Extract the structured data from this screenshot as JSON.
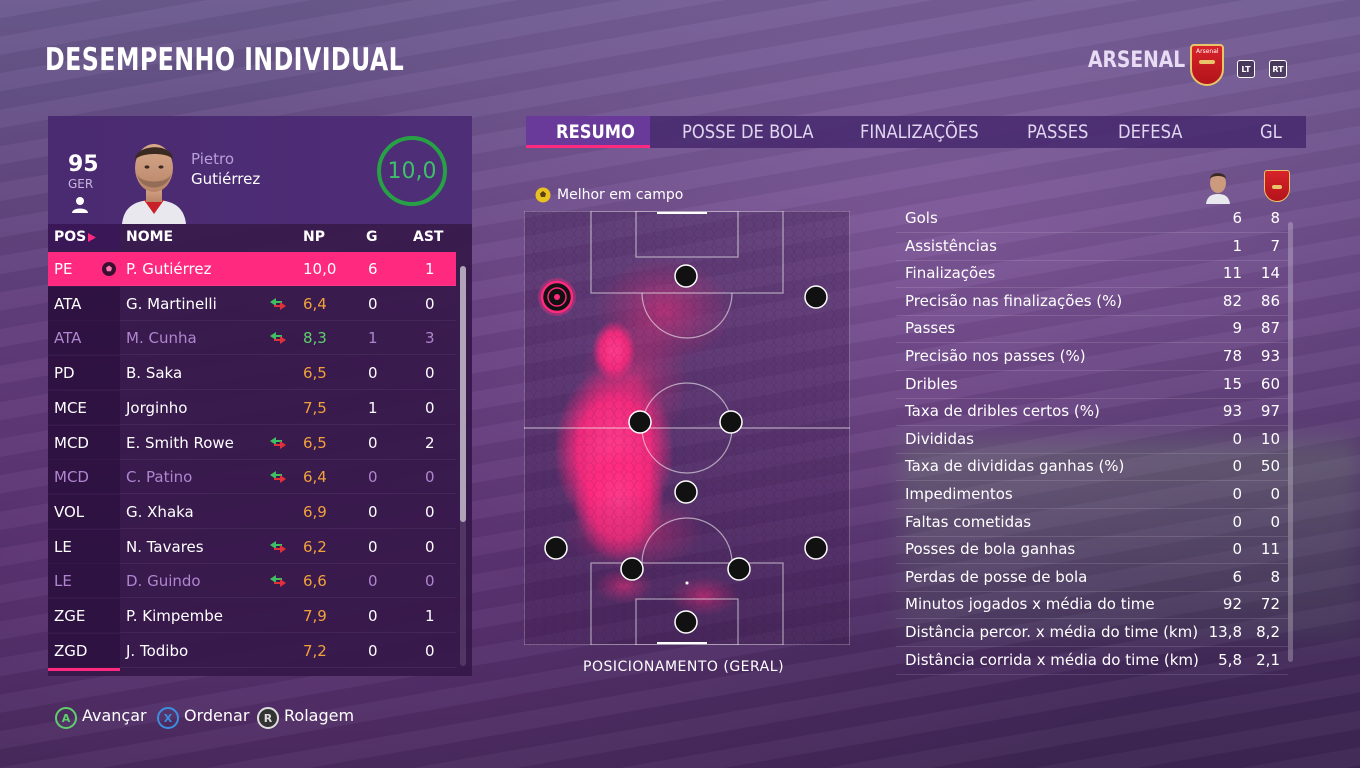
{
  "page_title": "DESEMPENHO INDIVIDUAL",
  "team": {
    "name": "ARSENAL",
    "crest_label": "Arsenal",
    "left_trigger": "LT",
    "right_trigger": "RT"
  },
  "player": {
    "overall": "95",
    "nationality": "GER",
    "first_name": "Pietro",
    "last_name": "Gutiérrez",
    "match_rating": "10,0"
  },
  "table": {
    "headers": {
      "pos": "POS",
      "name": "NOME",
      "np": "NP",
      "g": "G",
      "ast": "AST"
    },
    "rows": [
      {
        "pos": "PE",
        "name": "P. Gutiérrez",
        "np": "10,0",
        "g": "6",
        "ast": "1",
        "selected": true,
        "sub": false,
        "dim": false,
        "np_color": "#ffffff"
      },
      {
        "pos": "ATA",
        "name": "G. Martinelli",
        "np": "6,4",
        "g": "0",
        "ast": "0",
        "selected": false,
        "sub": true,
        "dim": false,
        "np_color": "#f2a23a"
      },
      {
        "pos": "ATA",
        "name": "M. Cunha",
        "np": "8,3",
        "g": "1",
        "ast": "3",
        "selected": false,
        "sub": true,
        "dim": true,
        "np_color": "#5fcf6c"
      },
      {
        "pos": "PD",
        "name": "B. Saka",
        "np": "6,5",
        "g": "0",
        "ast": "0",
        "selected": false,
        "sub": false,
        "dim": false,
        "np_color": "#f2a23a"
      },
      {
        "pos": "MCE",
        "name": "Jorginho",
        "np": "7,5",
        "g": "1",
        "ast": "0",
        "selected": false,
        "sub": false,
        "dim": false,
        "np_color": "#f2a23a"
      },
      {
        "pos": "MCD",
        "name": "E. Smith Rowe",
        "np": "6,5",
        "g": "0",
        "ast": "2",
        "selected": false,
        "sub": true,
        "dim": false,
        "np_color": "#f2a23a"
      },
      {
        "pos": "MCD",
        "name": "C. Patino",
        "np": "6,4",
        "g": "0",
        "ast": "0",
        "selected": false,
        "sub": true,
        "dim": true,
        "np_color": "#f2a23a"
      },
      {
        "pos": "VOL",
        "name": "G. Xhaka",
        "np": "6,9",
        "g": "0",
        "ast": "0",
        "selected": false,
        "sub": false,
        "dim": false,
        "np_color": "#f2a23a"
      },
      {
        "pos": "LE",
        "name": "N. Tavares",
        "np": "6,2",
        "g": "0",
        "ast": "0",
        "selected": false,
        "sub": true,
        "dim": false,
        "np_color": "#f2a23a"
      },
      {
        "pos": "LE",
        "name": "D. Guindo",
        "np": "6,6",
        "g": "0",
        "ast": "0",
        "selected": false,
        "sub": true,
        "dim": true,
        "np_color": "#f2a23a"
      },
      {
        "pos": "ZGE",
        "name": "P. Kimpembe",
        "np": "7,9",
        "g": "0",
        "ast": "1",
        "selected": false,
        "sub": false,
        "dim": false,
        "np_color": "#f2a23a"
      },
      {
        "pos": "ZGD",
        "name": "J. Todibo",
        "np": "7,2",
        "g": "0",
        "ast": "0",
        "selected": false,
        "sub": false,
        "dim": false,
        "np_color": "#f2a23a"
      }
    ]
  },
  "tabs": [
    "RESUMO",
    "POSSE DE BOLA",
    "FINALIZAÇÕES",
    "PASSES",
    "DEFESA",
    "GL"
  ],
  "active_tab": "RESUMO",
  "motm_label": "Melhor em campo",
  "pitch_caption": "POSICIONAMENTO (GERAL)",
  "stats": [
    {
      "label": "Gols",
      "player": "6",
      "team": "8"
    },
    {
      "label": "Assistências",
      "player": "1",
      "team": "7"
    },
    {
      "label": "Finalizações",
      "player": "11",
      "team": "14"
    },
    {
      "label": "Precisão nas finalizações (%)",
      "player": "82",
      "team": "86"
    },
    {
      "label": "Passes",
      "player": "9",
      "team": "87"
    },
    {
      "label": "Precisão nos passes (%)",
      "player": "78",
      "team": "93"
    },
    {
      "label": "Dribles",
      "player": "15",
      "team": "60"
    },
    {
      "label": "Taxa de dribles certos (%)",
      "player": "93",
      "team": "97"
    },
    {
      "label": "Divididas",
      "player": "0",
      "team": "10"
    },
    {
      "label": "Taxa de divididas ganhas (%)",
      "player": "0",
      "team": "50"
    },
    {
      "label": "Impedimentos",
      "player": "0",
      "team": "0"
    },
    {
      "label": "Faltas cometidas",
      "player": "0",
      "team": "0"
    },
    {
      "label": "Posses de bola ganhas",
      "player": "0",
      "team": "11"
    },
    {
      "label": "Perdas de posse de bola",
      "player": "6",
      "team": "8"
    },
    {
      "label": "Minutos jogados x média do time",
      "player": "92",
      "team": "72"
    },
    {
      "label": "Distância percor. x média do time (km)",
      "player": "13,8",
      "team": "8,2"
    },
    {
      "label": "Distância corrida x média do time (km)",
      "player": "5,8",
      "team": "2,1"
    }
  ],
  "footer": {
    "a_label": "Avançar",
    "a_key": "A",
    "x_label": "Ordenar",
    "x_key": "X",
    "r_label": "Rolagem",
    "r_key": "R"
  },
  "colors": {
    "accent_pink": "#ff2a7f",
    "rating_green": "#27a046",
    "btn_a_green": "#5fcf6c",
    "btn_x_blue": "#3a8fe0"
  }
}
